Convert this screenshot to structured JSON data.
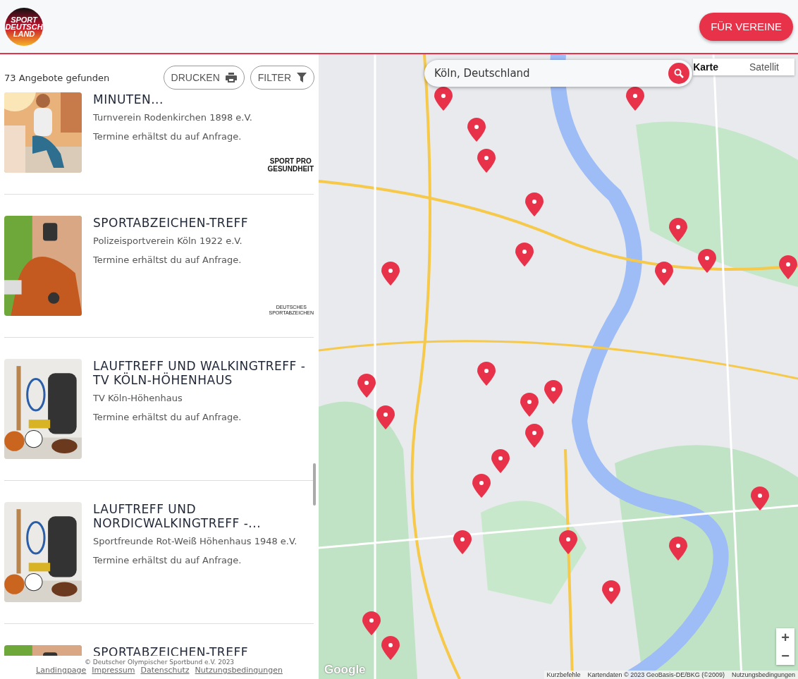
{
  "header": {
    "logo_lines": [
      "SPORT",
      "DEUTSCH",
      "LAND"
    ],
    "button": "FÜR VEREINE"
  },
  "results": {
    "count": "73 Angebote gefunden",
    "print": "DRUCKEN",
    "filter": "FILTER"
  },
  "offers": [
    {
      "title": "MINUTEN...",
      "club": "Turnverein Rodenkirchen 1898 e.V.",
      "dates": "Termine erhältst du auf Anfrage.",
      "kind": "picture",
      "badge": {
        "kind": "gesundheit",
        "lines": [
          "SPORT PRO",
          "GESUNDHEIT"
        ]
      }
    },
    {
      "title": "SPORTABZEICHEN-TREFF",
      "club": "Polizeisportverein Köln 1922 e.V.",
      "dates": "Termine erhältst du auf Anfrage.",
      "kind": "picture",
      "badge": {
        "kind": "abzeichen",
        "lines": [
          "DEUTSCHES",
          "SPORTABZEICHEN"
        ]
      }
    },
    {
      "title": "LAUFTREFF UND WALKINGTREFF - TV KÖLN-HÖHENHAUS",
      "club": "TV Köln-Höhenhaus",
      "dates": "Termine erhältst du auf Anfrage.",
      "kind": "picture"
    },
    {
      "title": "LAUFTREFF UND NORDICWALKINGTREFF -...",
      "club": "Sportfreunde Rot-Weiß Höhenhaus 1948 e.V.",
      "dates": "Termine erhältst du auf Anfrage.",
      "kind": "picture"
    },
    {
      "title": "SPORTABZEICHEN-TREFF",
      "kind": "picture"
    }
  ],
  "footer": {
    "copyright": "© Deutscher Olympischer Sportbund e.V. 2023",
    "links": [
      "Landingpage",
      "Impressum",
      "Datenschutz",
      "Nutzungsbedingungen"
    ]
  },
  "map": {
    "search": {
      "value": "Köln, Deutschland"
    },
    "map_types": [
      {
        "label": "Karte",
        "selected": true
      },
      {
        "label": "Satellit",
        "selected": false
      }
    ],
    "zoom_in": "+",
    "zoom_out": "−",
    "google": "Google",
    "attribution": [
      "Kurzbefehle",
      "Kartendaten © 2023 GeoBasis-DE/BKG (©2009)",
      "Nutzungsbedingungen"
    ]
  }
}
